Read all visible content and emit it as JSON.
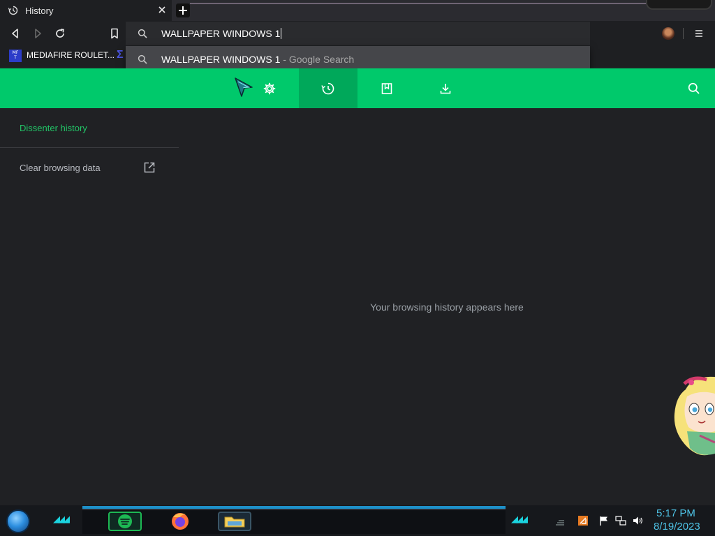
{
  "tab": {
    "title": "History"
  },
  "omnibox": {
    "value": "WALLPAPER WINDOWS 1"
  },
  "suggestion": {
    "query": "WALLPAPER WINDOWS 1",
    "separator": " - ",
    "source": "Google Search"
  },
  "bookmarks": {
    "items": [
      {
        "label": "MEDIAFIRE ROULET...",
        "favicon_text": "MF T"
      }
    ]
  },
  "nav": {
    "icons": [
      "gear-icon",
      "history-icon",
      "bookmark-icon",
      "download-icon",
      "search-icon"
    ],
    "active": "history-icon"
  },
  "sidebar": {
    "title": "Dissenter history",
    "clear_label": "Clear browsing data"
  },
  "main": {
    "empty_message": "Your browsing history appears here"
  },
  "taskbar": {
    "time": "5:17 PM",
    "date": "8/19/2023"
  },
  "colors": {
    "accent_green": "#00c96b",
    "accent_green_active": "#00a85a",
    "link_green": "#22c567",
    "background": "#202124",
    "clock_cyan": "#4ec3e6"
  }
}
